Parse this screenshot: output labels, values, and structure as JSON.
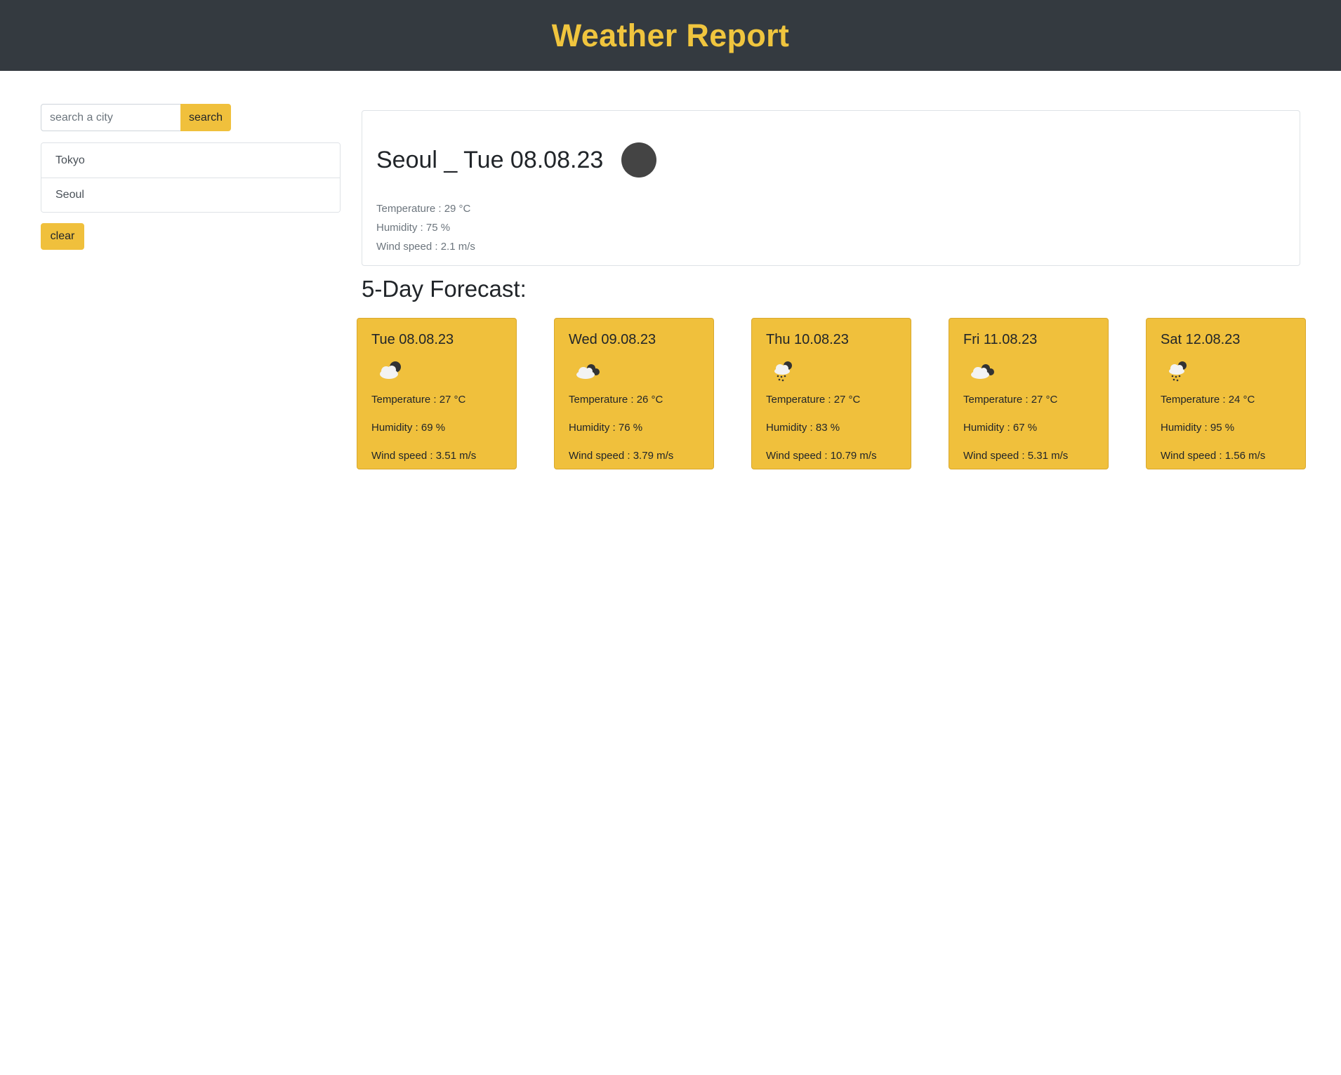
{
  "header": {
    "title": "Weather Report"
  },
  "search": {
    "placeholder": "search a city",
    "button_label": "search"
  },
  "history": {
    "cities": [
      "Tokyo",
      "Seoul"
    ],
    "clear_label": "clear"
  },
  "current": {
    "title": "Seoul _ Tue 08.08.23",
    "icon": "dark-circle-icon",
    "temperature": "Temperature : 29 °C",
    "humidity": "Humidity : 75 %",
    "wind": "Wind speed : 2.1 m/s"
  },
  "forecast": {
    "heading": "5-Day Forecast:",
    "days": [
      {
        "date": "Tue 08.08.23",
        "icon": "cloud-moon-icon",
        "temperature": "Temperature : 27 °C",
        "humidity": "Humidity : 69 %",
        "wind": "Wind speed : 3.51 m/s"
      },
      {
        "date": "Wed 09.08.23",
        "icon": "broken-clouds-icon",
        "temperature": "Temperature : 26 °C",
        "humidity": "Humidity : 76 %",
        "wind": "Wind speed : 3.79 m/s"
      },
      {
        "date": "Thu 10.08.23",
        "icon": "rain-cloud-icon",
        "temperature": "Temperature : 27 °C",
        "humidity": "Humidity : 83 %",
        "wind": "Wind speed : 10.79 m/s"
      },
      {
        "date": "Fri 11.08.23",
        "icon": "broken-clouds-icon",
        "temperature": "Temperature : 27 °C",
        "humidity": "Humidity : 67 %",
        "wind": "Wind speed : 5.31 m/s"
      },
      {
        "date": "Sat 12.08.23",
        "icon": "rain-cloud-icon",
        "temperature": "Temperature : 24 °C",
        "humidity": "Humidity : 95 %",
        "wind": "Wind speed : 1.56 m/s"
      }
    ]
  },
  "colors": {
    "header_bg": "#343a40",
    "accent": "#f0c03c",
    "title_yellow": "#f0c53e"
  }
}
